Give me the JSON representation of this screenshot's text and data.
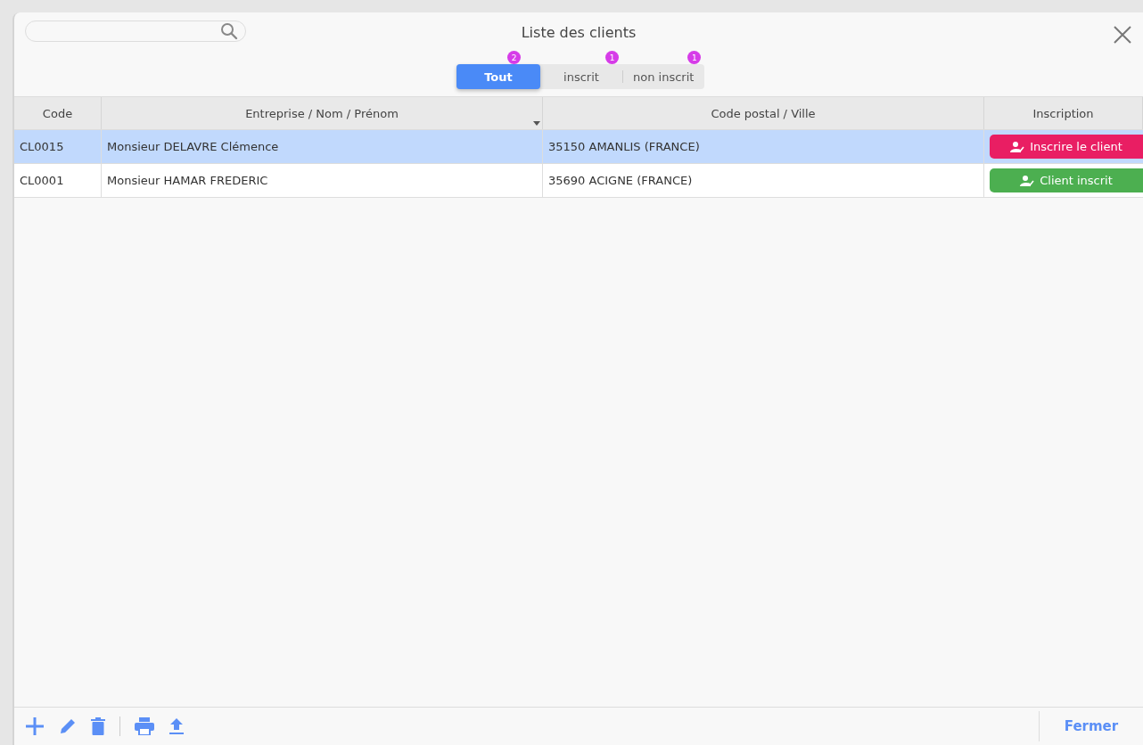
{
  "window": {
    "title": "Liste des clients"
  },
  "tabs": [
    {
      "label": "Tout",
      "badge": "2",
      "selected": true
    },
    {
      "label": "inscrit",
      "badge": "1",
      "selected": false
    },
    {
      "label": "non inscrit",
      "badge": "1",
      "selected": false
    }
  ],
  "table": {
    "columns": [
      "Code",
      "Entreprise / Nom / Prénom",
      "Code postal / Ville",
      "Inscription"
    ],
    "rows": [
      {
        "code": "CL0015",
        "name": "Monsieur DELAVRE Clémence",
        "city": "35150 AMANLIS (FRANCE)",
        "action": {
          "kind": "register",
          "label": "Inscrire le client"
        },
        "selected": true
      },
      {
        "code": "CL0001",
        "name": "Monsieur HAMAR FREDERIC",
        "city": "35690 ACIGNE (FRANCE)",
        "action": {
          "kind": "registered",
          "label": "Client inscrit"
        },
        "selected": false
      }
    ]
  },
  "footer": {
    "close": "Fermer"
  }
}
